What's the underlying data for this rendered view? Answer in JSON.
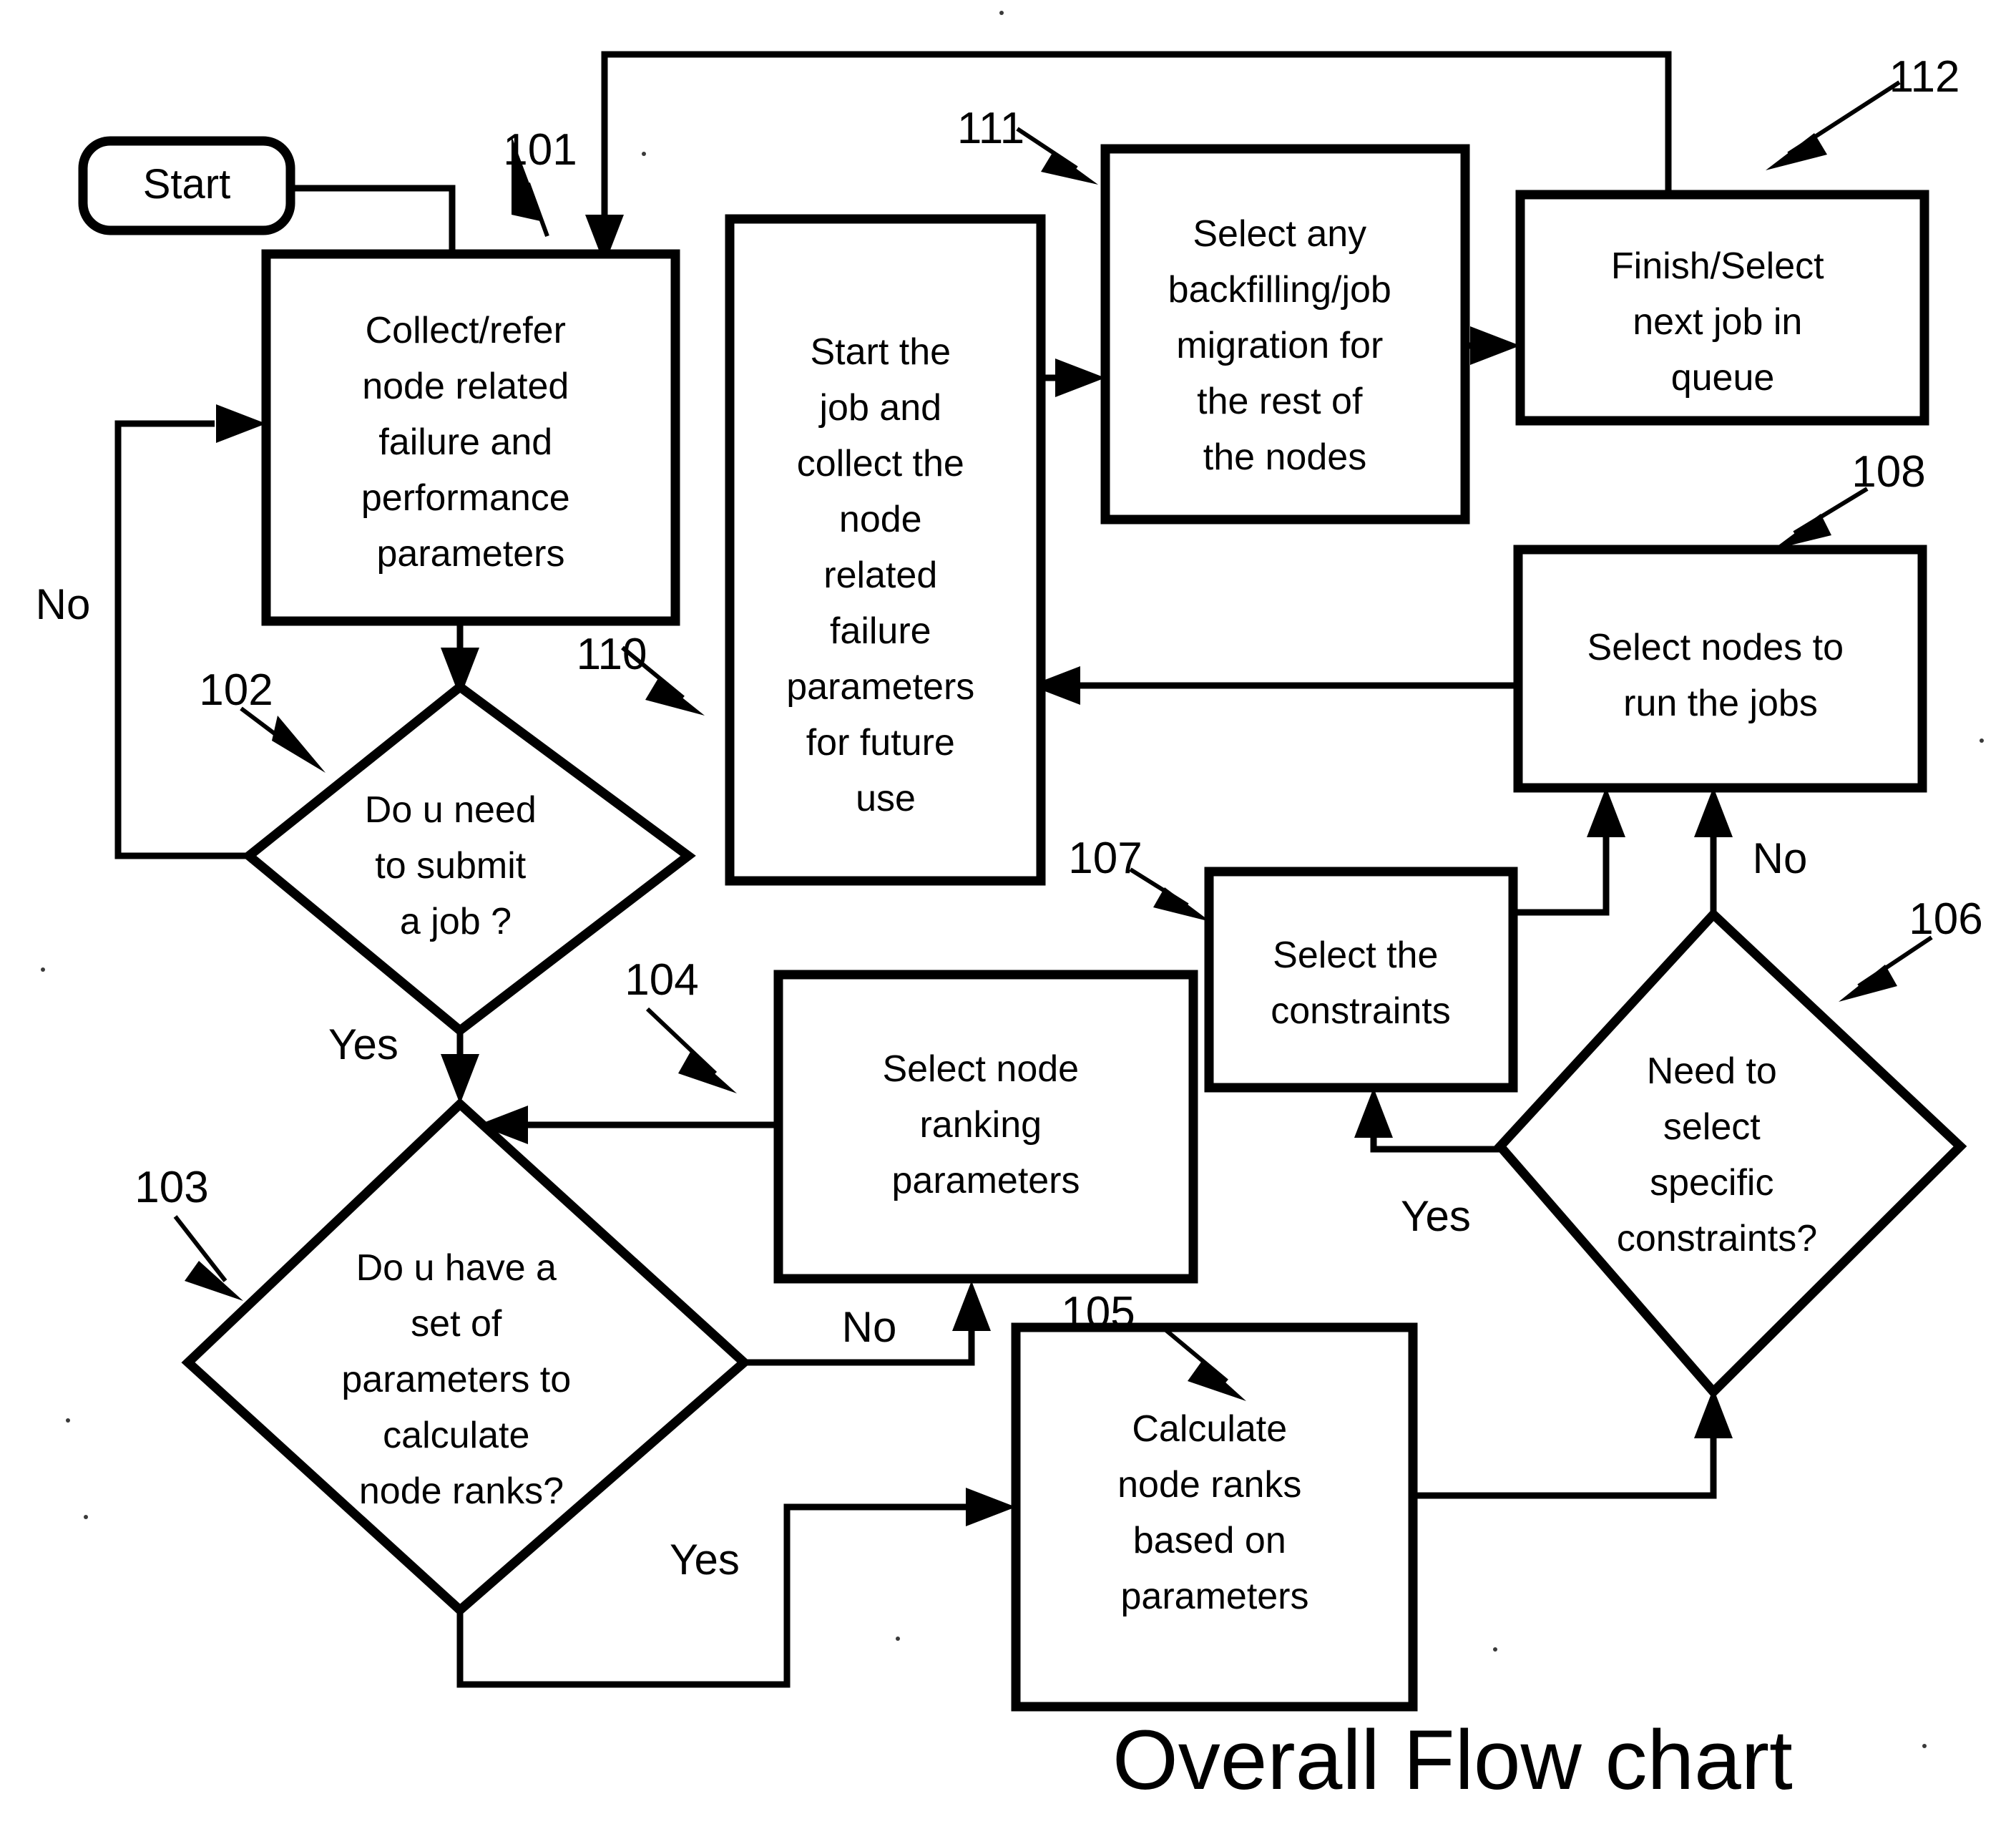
{
  "diagram": {
    "title": "Overall Flow chart",
    "background_color": "#ffffff",
    "line_color": "#000000"
  },
  "nodes": {
    "start": {
      "shape": "rounded-rectangle",
      "label": "Start"
    },
    "collect": {
      "ref": "101",
      "shape": "rectangle",
      "lines": [
        "Collect/refer",
        "node related",
        "failure and",
        "performance",
        "parameters"
      ]
    },
    "submit_decision": {
      "ref": "102",
      "shape": "diamond",
      "lines": [
        "Do u need",
        "to submit",
        "a job ?"
      ],
      "yes_label": "Yes",
      "no_label": "No"
    },
    "params_decision": {
      "ref": "103",
      "shape": "diamond",
      "lines": [
        "Do u have a",
        "set of",
        "parameters to",
        "calculate",
        "node ranks?"
      ],
      "yes_label": "Yes",
      "no_label": "No"
    },
    "select_ranking": {
      "ref": "104",
      "shape": "rectangle",
      "lines": [
        "Select node",
        "ranking",
        "parameters"
      ]
    },
    "calculate_ranks": {
      "ref": "105",
      "shape": "rectangle",
      "lines": [
        "Calculate",
        "node ranks",
        "based on",
        "parameters"
      ]
    },
    "constraints_decision": {
      "ref": "106",
      "shape": "diamond",
      "lines": [
        "Need to",
        "select",
        "specific",
        "constraints?"
      ],
      "yes_label": "Yes",
      "no_label": "No"
    },
    "select_constraints": {
      "ref": "107",
      "shape": "rectangle",
      "lines": [
        "Select the",
        "constraints"
      ]
    },
    "select_nodes": {
      "ref": "108",
      "shape": "rectangle",
      "lines": [
        "Select nodes to",
        "run the jobs"
      ]
    },
    "start_job": {
      "ref": "110",
      "shape": "rectangle",
      "lines": [
        "Start the",
        "job and",
        "collect the",
        "node",
        "related",
        "failure",
        "parameters",
        "for future",
        "use"
      ]
    },
    "backfilling": {
      "ref": "111",
      "shape": "rectangle",
      "lines": [
        "Select  any",
        "backfilling/job",
        "migration for",
        "the rest of",
        "the nodes"
      ]
    },
    "finish": {
      "ref": "112",
      "shape": "rectangle",
      "lines": [
        "Finish/Select",
        "next job in",
        "queue"
      ]
    }
  },
  "ref_numbers": [
    "101",
    "102",
    "103",
    "104",
    "105",
    "106",
    "107",
    "108",
    "110",
    "111",
    "112"
  ],
  "branch_labels": {
    "submit_no": "No",
    "submit_yes": "Yes",
    "params_no": "No",
    "params_yes": "Yes",
    "constraints_no": "No",
    "constraints_yes": "Yes"
  }
}
